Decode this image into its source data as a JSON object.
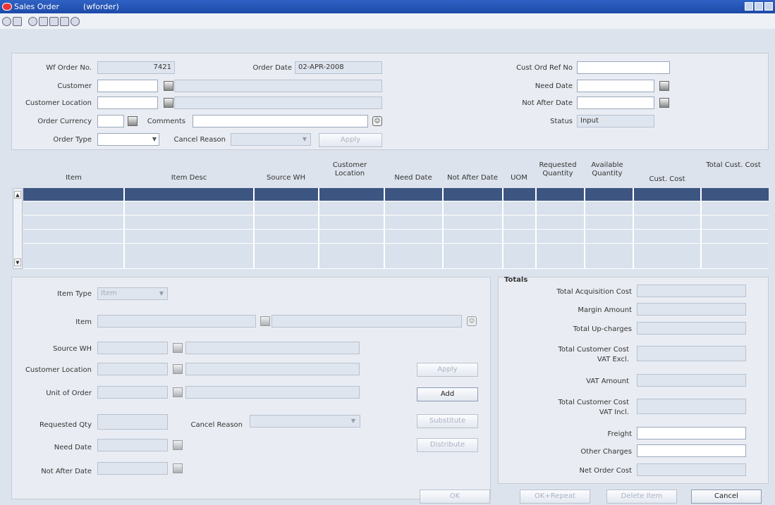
{
  "window": {
    "title": "Sales Order",
    "subtitle": "(wforder)"
  },
  "header": {
    "order_no_label": "Wf Order No.",
    "order_no_value": "7421",
    "order_date_label": "Order Date",
    "order_date_value": "02-APR-2008",
    "customer_label": "Customer",
    "customer_location_label": "Customer Location",
    "order_currency_label": "Order Currency",
    "comments_label": "Comments",
    "order_type_label": "Order Type",
    "cancel_reason_label": "Cancel Reason",
    "apply_label": "Apply",
    "cust_ord_ref_label": "Cust Ord Ref No",
    "need_date_label": "Need Date",
    "not_after_date_label": "Not After Date",
    "status_label": "Status",
    "status_value": "Input"
  },
  "grid": {
    "columns": [
      "Item",
      "Item Desc",
      "Source WH",
      "Customer Location",
      "Need Date",
      "Not After Date",
      "UOM",
      "Requested Quantity",
      "Available Quantity",
      "Cust. Cost",
      "Total Cust. Cost"
    ]
  },
  "detail": {
    "item_type_label": "Item Type",
    "item_type_value": "Item",
    "item_label": "Item",
    "source_wh_label": "Source WH",
    "customer_location_label": "Customer Location",
    "unit_of_order_label": "Unit of Order",
    "requested_qty_label": "Requested Qty",
    "cancel_reason_label": "Cancel Reason",
    "need_date_label": "Need Date",
    "not_after_date_label": "Not After Date",
    "apply_label": "Apply",
    "add_label": "Add",
    "substitute_label": "Substitute",
    "distribute_label": "Distribute"
  },
  "totals": {
    "title": "Totals",
    "acq_cost_label": "Total Acquisition Cost",
    "margin_label": "Margin Amount",
    "upcharges_label": "Total Up-charges",
    "cust_cost_excl_label_1": "Total Customer Cost",
    "cust_cost_excl_label_2": "VAT Excl.",
    "vat_amount_label": "VAT Amount",
    "cust_cost_incl_label_1": "Total Customer Cost",
    "cust_cost_incl_label_2": "VAT Incl.",
    "freight_label": "Freight",
    "other_charges_label": "Other Charges",
    "net_order_cost_label": "Net Order Cost"
  },
  "footer": {
    "ok_label": "OK",
    "ok_repeat_label": "OK+Repeat",
    "delete_item_label": "Delete Item",
    "cancel_label": "Cancel"
  }
}
